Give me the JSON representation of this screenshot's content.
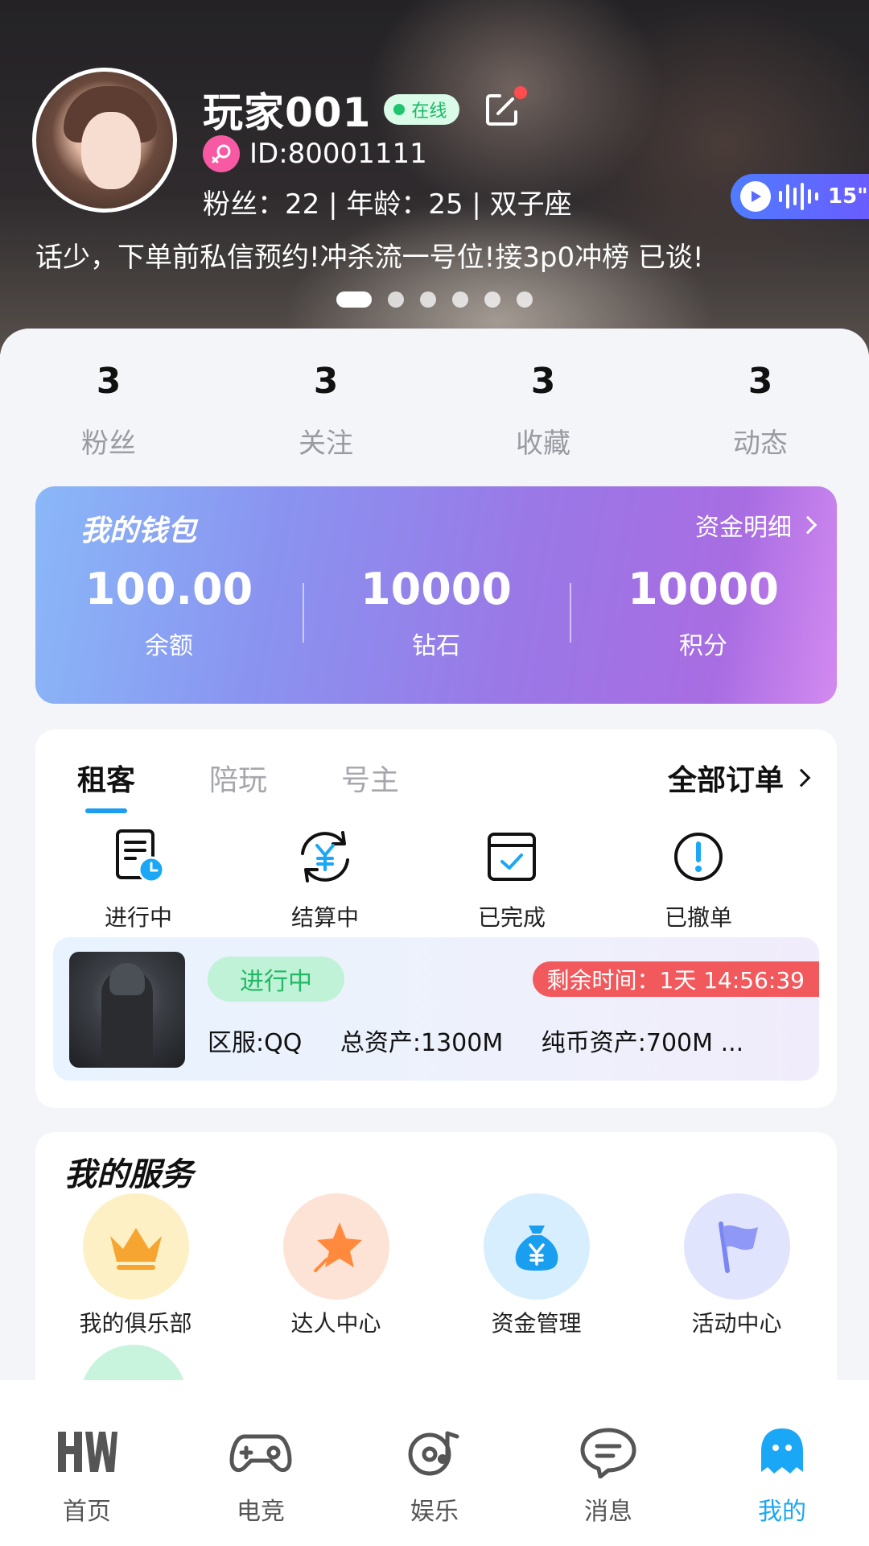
{
  "profile": {
    "name": "玩家001",
    "online_label": "在线",
    "id": "ID:80001111",
    "stats": "粉丝：22 | 年龄：25 | 双子座",
    "bio": "话少，下单前私信预约!冲杀流一号位!接3p0冲榜  已谈!",
    "voice_duration": "15\"",
    "carousel": {
      "total": 6,
      "active": 1
    }
  },
  "counts": [
    {
      "value": "3",
      "label": "粉丝"
    },
    {
      "value": "3",
      "label": "关注"
    },
    {
      "value": "3",
      "label": "收藏"
    },
    {
      "value": "3",
      "label": "动态"
    }
  ],
  "wallet": {
    "title": "我的钱包",
    "detail_link": "资金明细",
    "items": [
      {
        "value": "100.00",
        "label": "余额"
      },
      {
        "value": "10000",
        "label": "钻石"
      },
      {
        "value": "10000",
        "label": "积分"
      }
    ]
  },
  "orders": {
    "tabs": [
      "租客",
      "陪玩",
      "号主"
    ],
    "active_tab": "租客",
    "all_orders": "全部订单",
    "statuses": [
      {
        "label": "进行中",
        "icon": "document-clock-icon"
      },
      {
        "label": "结算中",
        "icon": "yuan-cycle-icon"
      },
      {
        "label": "已完成",
        "icon": "calendar-check-icon"
      },
      {
        "label": "已撤单",
        "icon": "exclamation-circle-icon"
      }
    ],
    "card": {
      "status": "进行中",
      "remaining": "剩余时间：1天 14:56:39",
      "specs": [
        "区服:QQ",
        "总资产:1300M",
        "纯币资产:700M ..."
      ]
    }
  },
  "services": {
    "title": "我的服务",
    "items": [
      {
        "label": "我的俱乐部",
        "icon": "crown-icon",
        "bg": "#fdf0c4"
      },
      {
        "label": "达人中心",
        "icon": "star-icon",
        "bg": "#fde3d6"
      },
      {
        "label": "资金管理",
        "icon": "money-bag-icon",
        "bg": "#d6eefd"
      },
      {
        "label": "活动中心",
        "icon": "flag-icon",
        "bg": "#e1e4fd"
      }
    ]
  },
  "tabbar": [
    {
      "label": "首页",
      "icon": "hw-logo-icon"
    },
    {
      "label": "电竞",
      "icon": "gamepad-icon"
    },
    {
      "label": "娱乐",
      "icon": "music-disc-icon"
    },
    {
      "label": "消息",
      "icon": "chat-bubble-icon"
    },
    {
      "label": "我的",
      "icon": "ghost-user-icon"
    }
  ],
  "active_tab": "我的",
  "colors": {
    "accent": "#1aa7f5",
    "online": "#1fc46e",
    "danger": "#f2595c"
  }
}
